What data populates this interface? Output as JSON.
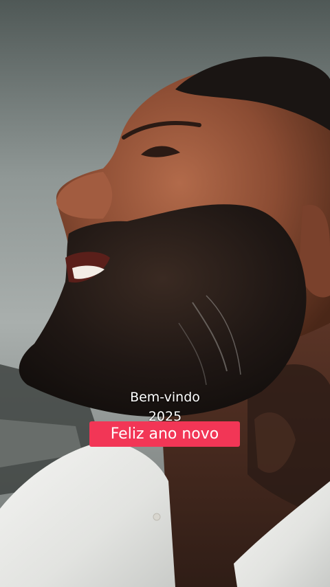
{
  "caption": {
    "line1": "Bem-vindo",
    "line2": "2025",
    "highlight": "Feliz ano novo"
  },
  "colors": {
    "highlight_bg": "#f23656",
    "caption_text": "#ffffff"
  }
}
